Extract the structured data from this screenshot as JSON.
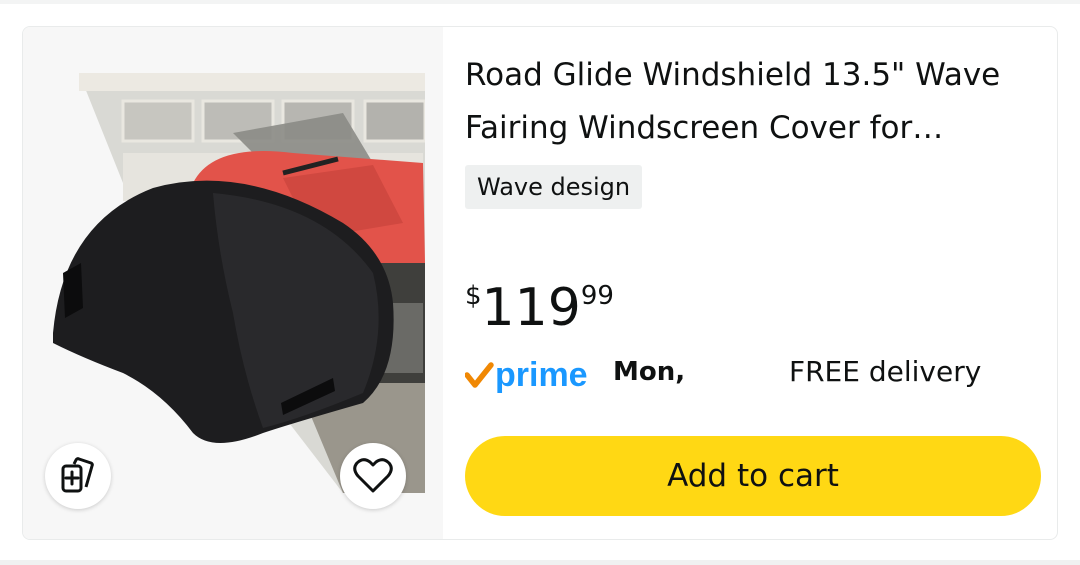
{
  "product": {
    "title": "Road Glide Windshield 13.5\" Wave Fairing Windscreen Cover for…",
    "badge": "Wave design",
    "price": {
      "currency_symbol": "$",
      "whole": "119",
      "fraction": "99"
    },
    "delivery": {
      "prime_label": "prime",
      "date_partial": "Mon, ",
      "free_delivery": "FREE delivery"
    },
    "add_to_cart_label": "Add to cart"
  },
  "icons": {
    "compare": "compare-cards-icon",
    "wishlist": "heart-icon",
    "prime": "prime-check-logo"
  },
  "colors": {
    "add_to_cart_bg": "#FFD814",
    "prime_blue": "#1A98FF",
    "prime_check": "#F08804",
    "badge_bg": "#EEF0F0",
    "media_bg": "#F7F7F7"
  }
}
